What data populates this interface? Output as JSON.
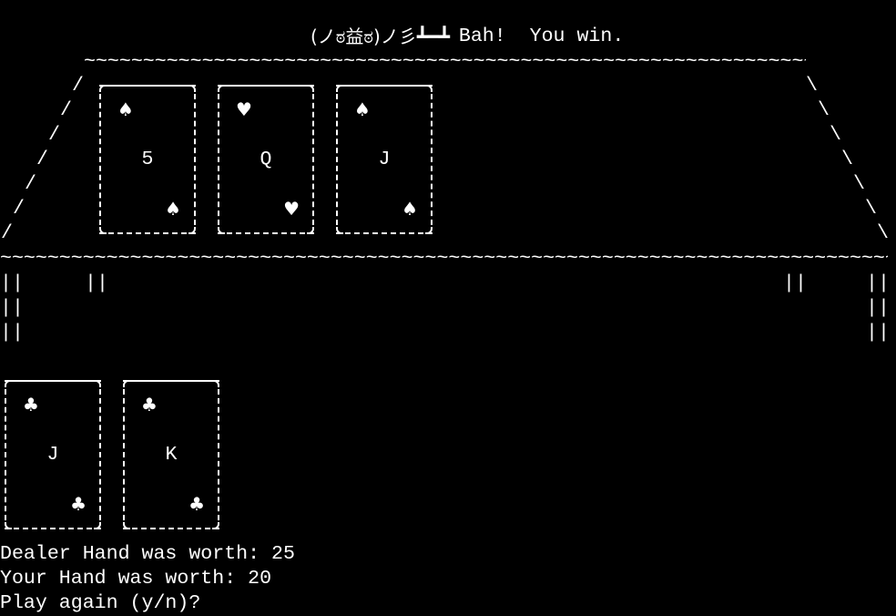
{
  "banner": {
    "face": "(ノಠ益ಠ)ノ彡┻━┻",
    "message": "Bah!  You win."
  },
  "table": {
    "top_edge": "~~~~~~~~~~~~~~~~~~~~~~~~~~~~~~~~~~~~~~~~~~~~~~~~~~~~~~~~~~~~~~~~~~~~~~~~~~~~~~~~~~~~~~~~~~~~~",
    "edge": "~~~~~~~~~~~~~~~~~~~~~~~~~~~~~~~~~~~~~~~~~~~~~~~~~~~~~~~~~~~~~~~~~~~~~~~~~~~~~~~~~~~~~~~~~~~~~~~~~~~~~~~~~~~~~~~~~~~~~~~~~~~~~~~",
    "left_leg": "/",
    "right_leg": "\\",
    "rail": "||"
  },
  "dealer_hand": [
    {
      "rank": "5",
      "suit": "♠"
    },
    {
      "rank": "Q",
      "suit": "♥"
    },
    {
      "rank": "J",
      "suit": "♠"
    }
  ],
  "player_hand": [
    {
      "rank": "J",
      "suit": "♣"
    },
    {
      "rank": "K",
      "suit": "♣"
    }
  ],
  "console": {
    "dealer_total": "Dealer Hand was worth: 25",
    "player_total": "Your Hand was worth: 20",
    "prompt": "Play again (y/n)?"
  }
}
